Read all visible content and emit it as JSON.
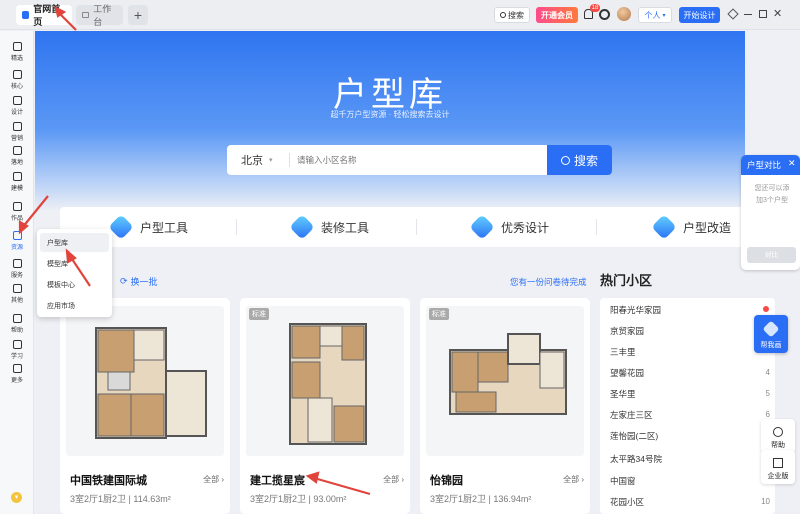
{
  "topbar": {
    "tab_home": "官网首页",
    "tab_workspace": "工作台",
    "search_label": "搜索",
    "vip_label": "开通会员",
    "notification_count": "18",
    "personal_label": "个人",
    "start_design_label": "开始设计"
  },
  "sidebar": {
    "items": [
      {
        "label": "精选"
      },
      {
        "label": "核心"
      },
      {
        "label": "设计"
      },
      {
        "label": "营销"
      },
      {
        "label": "落地"
      },
      {
        "label": "建模"
      },
      {
        "label": "作品"
      },
      {
        "label": "资源"
      },
      {
        "label": "服务"
      },
      {
        "label": "其他"
      },
      {
        "label": "帮助"
      },
      {
        "label": "学习"
      },
      {
        "label": "更多"
      }
    ]
  },
  "dropdown": {
    "items": [
      {
        "label": "户型库"
      },
      {
        "label": "模型库"
      },
      {
        "label": "模板中心"
      },
      {
        "label": "应用市场"
      }
    ]
  },
  "hero": {
    "title": "户型库",
    "subtitle": "超千万户型资源 · 轻松搜索去设计",
    "city": "北京",
    "search_placeholder": "请输入小区名称",
    "search_button": "搜索"
  },
  "tools": [
    {
      "label": "户型工具"
    },
    {
      "label": "装修工具"
    },
    {
      "label": "优秀设计"
    },
    {
      "label": "户型改造"
    }
  ],
  "listing": {
    "refresh_label": "换一批",
    "finish_prompt": "您有一份问卷待完成",
    "more_label": "全部 ›"
  },
  "cards": [
    {
      "name": "中国铁建国际城",
      "info": "3室2厅1厨2卫",
      "area": "114.63m²",
      "tag": ""
    },
    {
      "name": "建工揽星宸",
      "info": "3室2厅1厨2卫",
      "area": "93.00m²",
      "tag": "标准"
    },
    {
      "name": "怡锦园",
      "info": "3室2厅1厨2卫",
      "area": "136.94m²",
      "tag": "标准"
    }
  ],
  "hot": {
    "title": "热门小区",
    "items": [
      {
        "name": "阳春光华家园",
        "num": ""
      },
      {
        "name": "京贸家园",
        "num": ""
      },
      {
        "name": "三丰里",
        "num": ""
      },
      {
        "name": "望馨花园",
        "num": "4"
      },
      {
        "name": "圣华里",
        "num": "5"
      },
      {
        "name": "左家庄三区",
        "num": "6"
      },
      {
        "name": "莲怡园(二区)",
        "num": "7"
      },
      {
        "name": "太平路34号院",
        "num": "8"
      },
      {
        "name": "中国窗",
        "num": "9"
      },
      {
        "name": "花园小区",
        "num": "10"
      }
    ]
  },
  "compare": {
    "title": "户型对比",
    "desc": "您还可以添加3个户型",
    "button": "对比"
  },
  "floats": {
    "helper": "帮我画",
    "help": "帮助",
    "enterprise": "企业版"
  },
  "colors": {
    "accent": "#2a6ef5",
    "hero_top": "#2f75f0"
  }
}
